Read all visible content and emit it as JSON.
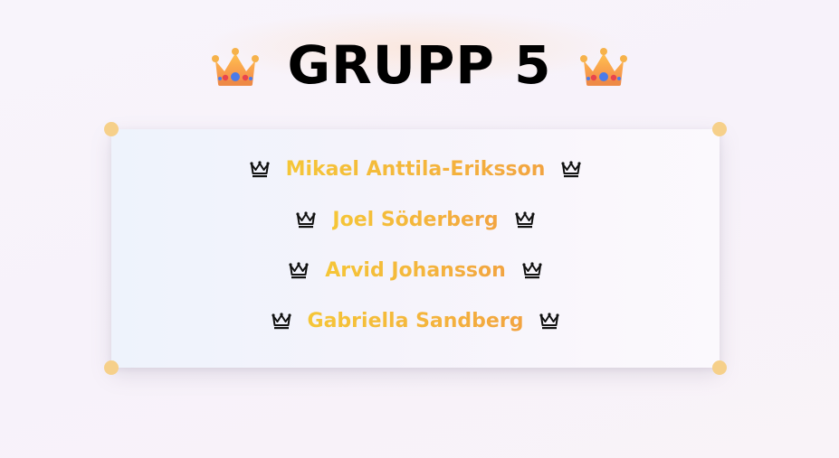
{
  "page": {
    "title": "GRUPP 5",
    "title_icon": "crown-emoji"
  },
  "members": [
    {
      "name": "Mikael Anttila-Eriksson"
    },
    {
      "name": "Joel Söderberg"
    },
    {
      "name": "Arvid Johansson"
    },
    {
      "name": "Gabriella Sandberg"
    }
  ],
  "icons": {
    "member_prefix": "crown-outline-icon",
    "member_suffix": "crown-outline-icon"
  },
  "colors": {
    "background": "#f8f4fb",
    "card": "#f6f5fb",
    "pin": "#f6d08a",
    "name_gradient_start": "#f5c637",
    "name_gradient_end": "#f2a441",
    "title": "#000000"
  }
}
